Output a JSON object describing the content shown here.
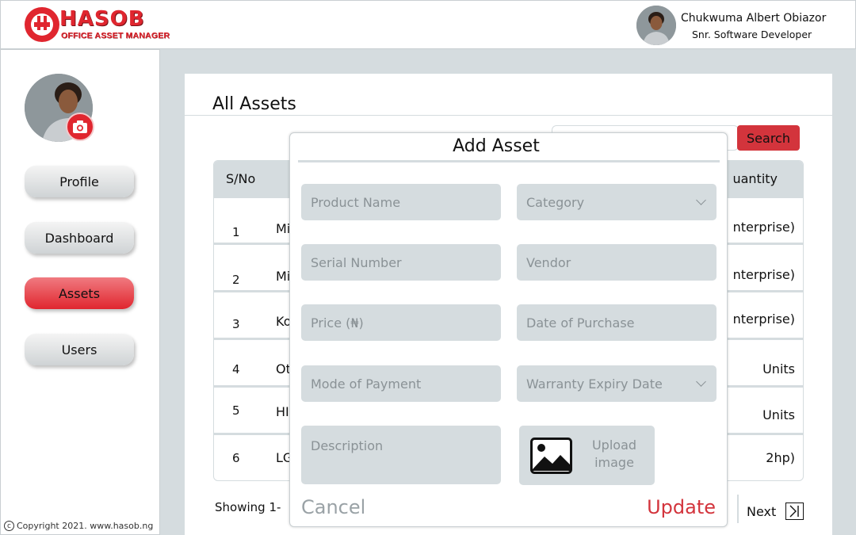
{
  "brand": {
    "title": "HASOB",
    "subtitle": "OFFICE ASSET MANAGER",
    "color": "#e0262f"
  },
  "user": {
    "name": "Chukwuma Albert Obiazor",
    "role": "Snr. Software Developer"
  },
  "sidebar": {
    "items": [
      {
        "label": "Profile",
        "active": false
      },
      {
        "label": "Dashboard",
        "active": false
      },
      {
        "label": "Assets",
        "active": true
      },
      {
        "label": "Users",
        "active": false
      }
    ],
    "copyright": "Copyright 2021. www.hasob.ng"
  },
  "page": {
    "title": "All Assets",
    "search_label": "Search"
  },
  "table": {
    "headers": {
      "sno": "S/No",
      "quantity": "uantity"
    },
    "rows": [
      {
        "sno": "1",
        "name": "Mi",
        "qty": "nterprise)"
      },
      {
        "sno": "2",
        "name": "Mi",
        "qty": "nterprise)"
      },
      {
        "sno": "3",
        "name": "Ko",
        "qty": "nterprise)"
      },
      {
        "sno": "4",
        "name": "Ot",
        "qty": "Units"
      },
      {
        "sno": "5",
        "name": "HI",
        "qty": "Units"
      },
      {
        "sno": "6",
        "name": "LG",
        "qty": "2hp)"
      }
    ]
  },
  "pagination": {
    "showing": "Showing 1-",
    "next": "Next"
  },
  "modal": {
    "title": "Add Asset",
    "fields": {
      "product_name": "Product Name",
      "category": "Category",
      "serial_number": "Serial Number",
      "vendor": "Vendor",
      "price": "Price (₦)",
      "date_of_purchase": "Date of Purchase",
      "mode_of_payment": "Mode of Payment",
      "warranty_expiry": "Warranty Expiry Date",
      "description": "Description"
    },
    "upload_label": "Upload image",
    "cancel": "Cancel",
    "update": "Update"
  },
  "colors": {
    "accent": "#d3343c",
    "panel_bg": "#d5dcdf",
    "placeholder": "#8a9296"
  }
}
